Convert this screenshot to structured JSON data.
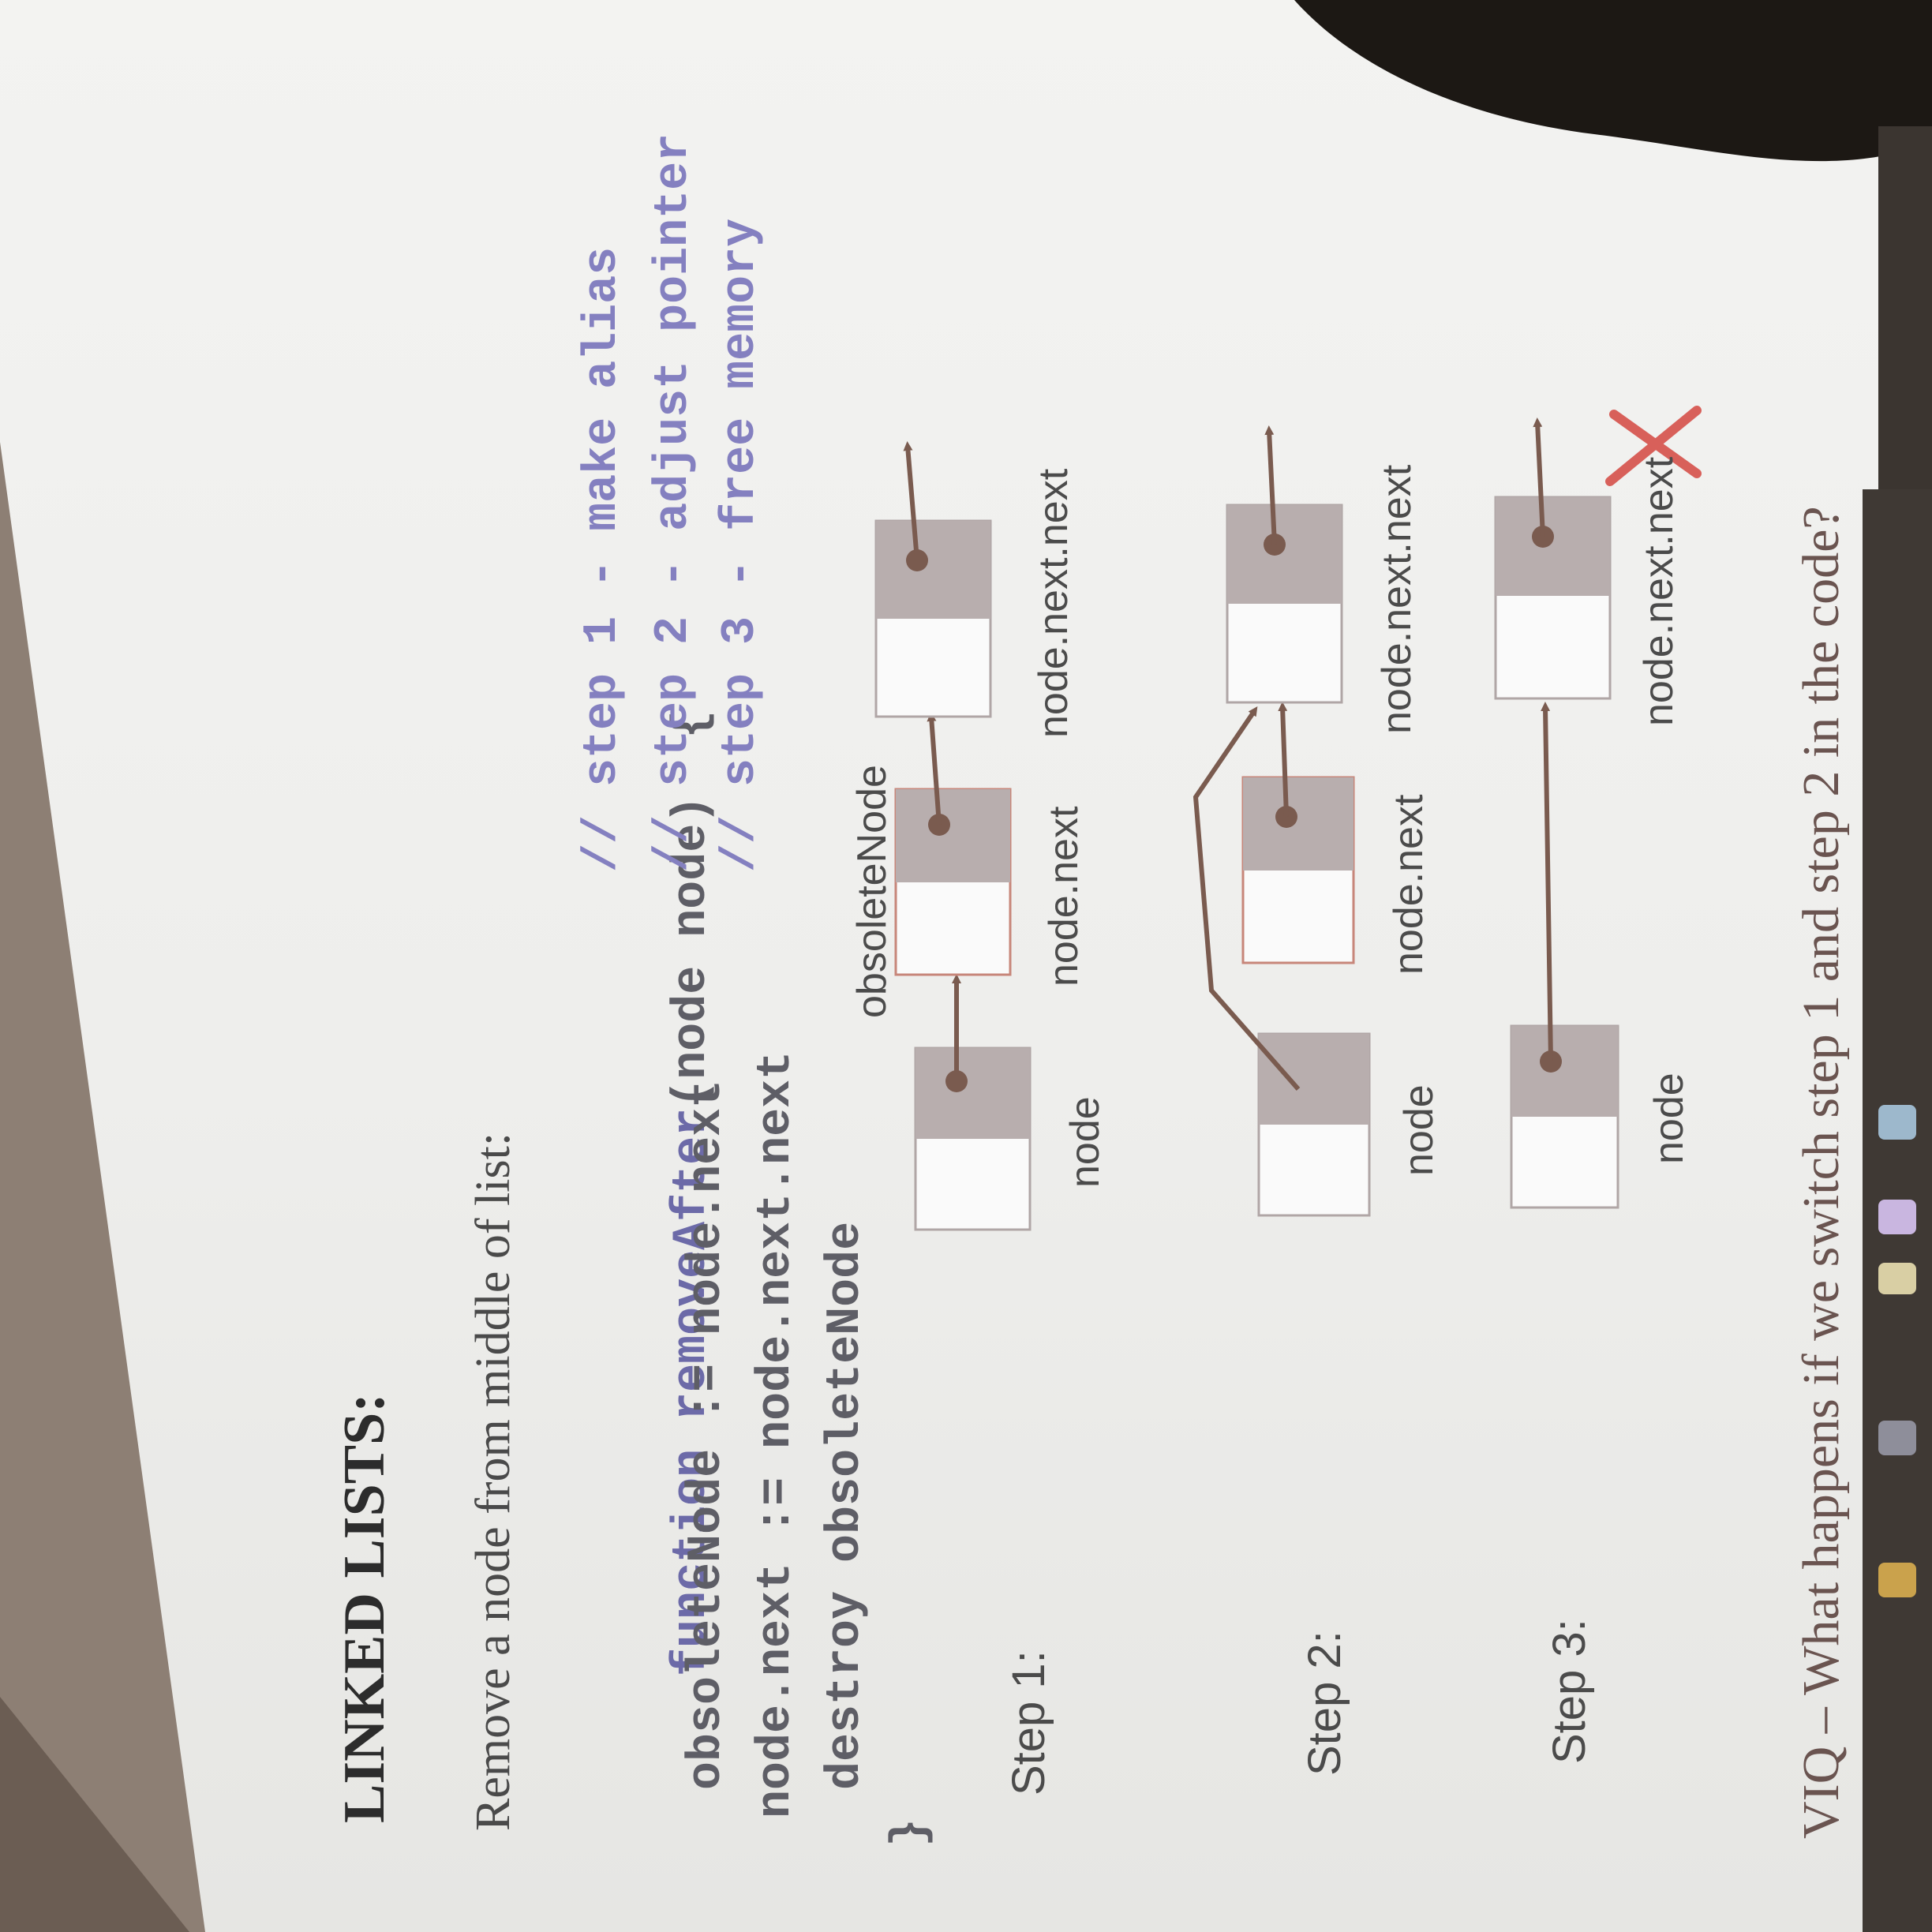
{
  "slide": {
    "title": "LINKED LISTS:",
    "subtitle": "Remove a node from middle of list:",
    "code": {
      "line1_kw": "function ",
      "line1_fn": "removeAfter",
      "line1_rest": "(node node)  {",
      "line2": "  obsoleteNode := node.next",
      "line3": " node.next := node.next.next",
      "line4": "  destroy obsoleteNode",
      "line5": "}",
      "comment1": "// step 1 - make alias",
      "comment2": "// step 2 - adjust pointer",
      "comment3": "// step 3 - free memory"
    },
    "steps": [
      {
        "label": "Step 1:",
        "node_labels": [
          "node",
          "node.next",
          "node.next.next"
        ],
        "top_label": "obsoleteNode"
      },
      {
        "label": "Step 2:",
        "node_labels": [
          "node",
          "node.next",
          "node.next.next"
        ]
      },
      {
        "label": "Step 3:",
        "node_labels": [
          "node",
          "node.next.next"
        ]
      }
    ],
    "question": "VIQ – What happens if we switch step 1 and step 2 in the code?"
  },
  "colors": {
    "node_fill_top": "#b8aeae",
    "node_border": "#b0a6a6",
    "obsolete_border": "#c7867a",
    "arrow": "#7a5b4f",
    "cross": "#d8605a",
    "code_keyword": "#6c6aa8"
  }
}
